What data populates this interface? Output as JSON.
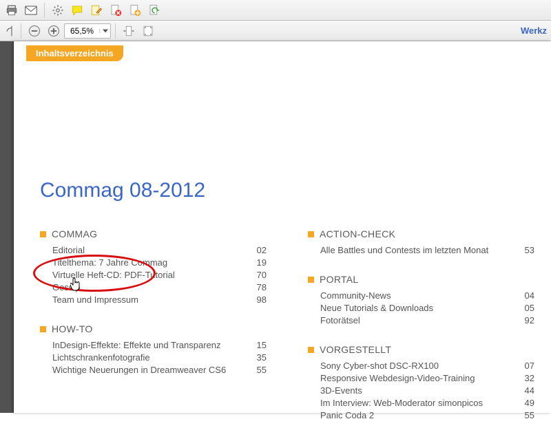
{
  "toolbar": {
    "zoom_value": "65,5%",
    "werkz": "Werkz"
  },
  "doc": {
    "tab_label": "Inhaltsverzeichnis",
    "title": "Commag 08-2012",
    "left_sections": [
      {
        "title": "COMMAG",
        "rows": [
          {
            "label": "Editorial",
            "page": "02"
          },
          {
            "label": "Titelthema: 7 Jahre Commag",
            "page": "19"
          },
          {
            "label": "Virtuelle Heft-CD: PDF-Tutorial",
            "page": "70"
          },
          {
            "label": "Gossip",
            "page": "78"
          },
          {
            "label": "Team und Impressum",
            "page": "98"
          }
        ]
      },
      {
        "title": "HOW-TO",
        "rows": [
          {
            "label": "InDesign-Effekte: Effekte und Transparenz",
            "page": "15"
          },
          {
            "label": "Lichtschrankenfotografie",
            "page": "35"
          },
          {
            "label": "Wichtige Neuerungen in Dreamweaver CS6",
            "page": "55"
          }
        ]
      }
    ],
    "right_sections": [
      {
        "title": "ACTION-CHECK",
        "rows": [
          {
            "label": "Alle Battles und Contests im letzten Monat",
            "page": "53"
          }
        ]
      },
      {
        "title": "PORTAL",
        "rows": [
          {
            "label": "Community-News",
            "page": "04"
          },
          {
            "label": "Neue Tutorials & Downloads",
            "page": "05"
          },
          {
            "label": "Fotorätsel",
            "page": "92"
          }
        ]
      },
      {
        "title": "VORGESTELLT",
        "rows": [
          {
            "label": "Sony Cyber-shot DSC-RX100",
            "page": "07"
          },
          {
            "label": "Responsive Webdesign-Video-Training",
            "page": "32"
          },
          {
            "label": "3D-Events",
            "page": "44"
          },
          {
            "label": "Im Interview: Web-Moderator simonpicos",
            "page": "49"
          },
          {
            "label": "Panic Coda 2",
            "page": "55"
          }
        ]
      }
    ]
  }
}
